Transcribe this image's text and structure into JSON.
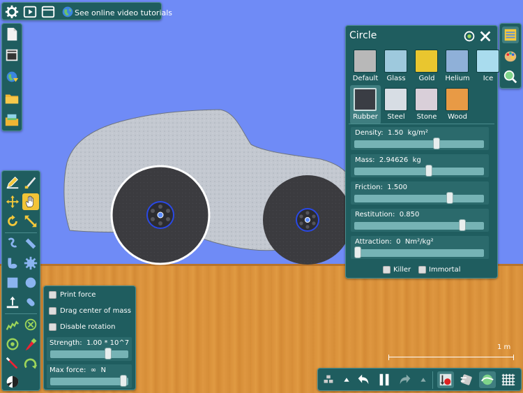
{
  "top_toolbar": {
    "tutorials_label": "See online video tutorials"
  },
  "properties": {
    "title": "Circle",
    "materials": [
      {
        "label": "Default",
        "color": "#b8b8b8"
      },
      {
        "label": "Glass",
        "color": "#9ec9dd"
      },
      {
        "label": "Gold",
        "color": "#e9c62f"
      },
      {
        "label": "Helium",
        "color": "#8fb0d8"
      },
      {
        "label": "Ice",
        "color": "#a9dcee"
      },
      {
        "label": "Rubber",
        "color": "#3a3d44"
      },
      {
        "label": "Steel",
        "color": "#d7dde4"
      },
      {
        "label": "Stone",
        "color": "#d9cfd9"
      },
      {
        "label": "Wood",
        "color": "#e89a45"
      }
    ],
    "selected_material": "Rubber",
    "density": {
      "label": "Density:",
      "value": "1.50",
      "unit": "kg/m²",
      "fraction": 0.64
    },
    "mass": {
      "label": "Mass:",
      "value": "2.94626",
      "unit": "kg",
      "fraction": 0.58
    },
    "friction": {
      "label": "Friction:",
      "value": "1.500",
      "fraction": 0.75
    },
    "restitution": {
      "label": "Restitution:",
      "value": "0.850",
      "fraction": 0.85
    },
    "attraction": {
      "label": "Attraction:",
      "value": "0",
      "unit": "Nm²/kg²",
      "fraction": 0.0
    },
    "killer_label": "Killer",
    "immortal_label": "Immortal"
  },
  "options": {
    "print_force": "Print force",
    "drag_center": "Drag center of mass",
    "disable_rotation": "Disable rotation",
    "strength": {
      "label": "Strength:",
      "value": "1.00 * 10^7",
      "fraction": 0.78
    },
    "max_force": {
      "label": "Max force:",
      "value": "∞",
      "unit": "N",
      "fraction": 1.0
    }
  },
  "scale": {
    "label": "1 m"
  },
  "colors": {
    "sky": "#6f8bf6",
    "ground": "#dc963f",
    "panel": "#1f5d5f",
    "car_body": "#c3c8d0",
    "wheel": "#3a3a3e",
    "axle_blue": "#2a49e6"
  }
}
